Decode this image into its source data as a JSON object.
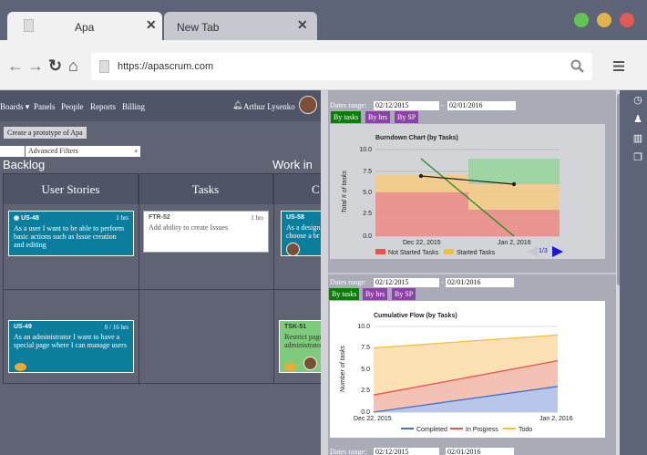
{
  "browser": {
    "tabs": [
      {
        "title": "Apa",
        "close": "✕"
      },
      {
        "title": "New Tab",
        "close": "✕"
      }
    ],
    "url": "https://apascrum.com",
    "window_colors": [
      "#61c554",
      "#e2b24b",
      "#e15b55"
    ]
  },
  "nav": {
    "items": [
      "Boards ▾",
      "Panels",
      "People",
      "Reports",
      "Billing"
    ],
    "user": "Arthur Lysenko"
  },
  "toolbar": {
    "prototype_button": "Create a prototype of Apa",
    "filter": "Advanced Filters"
  },
  "board": {
    "backlog_title": "Backlog",
    "wip_title": "Work in P",
    "columns": [
      "User Stories",
      "Tasks",
      "C"
    ],
    "cards": [
      {
        "id": "US-48",
        "hrs": "1 hrs",
        "text": "As a user I want to be able to perform basic actions such as Issue creation and editing"
      },
      {
        "id": "FTR-52",
        "hrs": "1 hrs",
        "text": "Add ability to create Issues"
      },
      {
        "id": "US-58",
        "hrs": "",
        "text": "As a design choose a br"
      },
      {
        "id": "US-49",
        "hrs": "0 / 16 hrs",
        "text": "As an administrator I want to have a special page where I can manage users"
      },
      {
        "id": "TSK-51",
        "hrs": "",
        "text": "Restrict page administrato"
      }
    ]
  },
  "reports": {
    "date_range_label": "Dates range:",
    "date_from": "02/12/2015",
    "date_to": "02/01/2016",
    "buttons": [
      "By tasks",
      "By hrs",
      "By SP"
    ],
    "pager": "1/3"
  },
  "chart_data": [
    {
      "type": "area",
      "title": "Burndown Chart (by Tasks)",
      "ylabel": "Total # of tasks",
      "ylim": [
        0,
        10
      ],
      "yticks": [
        "0.0",
        "2.5",
        "5.0",
        "7.5",
        "10.0"
      ],
      "xticks": [
        "Dec 22, 2015",
        "Jan 2, 2016"
      ],
      "series": [
        {
          "name": "Not Started Tasks",
          "color": "#e8534a"
        },
        {
          "name": "Started Tasks",
          "color": "#f5be3c"
        }
      ]
    },
    {
      "type": "area",
      "title": "Cumulative Flow (by Tasks)",
      "ylabel": "Number of tasks",
      "ylim": [
        0,
        10
      ],
      "yticks": [
        "0.0",
        "2.5",
        "5.0",
        "7.5",
        "10.0"
      ],
      "xticks": [
        "Dec 22, 2015",
        "Jan 2, 2016"
      ],
      "series": [
        {
          "name": "Completed",
          "color": "#4472c4",
          "values": [
            0,
            3
          ]
        },
        {
          "name": "In Progress",
          "color": "#e8534a",
          "values": [
            2,
            6
          ]
        },
        {
          "name": "Todo",
          "color": "#f5be3c",
          "values": [
            7.5,
            9
          ]
        }
      ]
    }
  ]
}
